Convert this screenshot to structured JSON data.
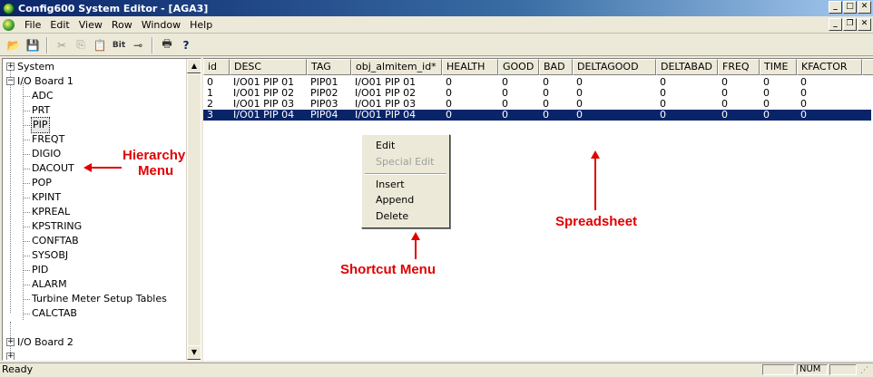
{
  "window": {
    "title": "Config600 System Editor - [AGA3]"
  },
  "menubar": {
    "items": [
      "File",
      "Edit",
      "View",
      "Row",
      "Window",
      "Help"
    ]
  },
  "toolbar": {
    "buttons": [
      {
        "icon": "open-icon",
        "glyph": "📂"
      },
      {
        "icon": "save-icon",
        "glyph": "💾"
      },
      {
        "icon": "cut-icon",
        "glyph": "✂"
      },
      {
        "icon": "copy-icon",
        "glyph": "⎘"
      },
      {
        "icon": "paste-icon",
        "glyph": "📋"
      },
      {
        "icon": "bits-icon",
        "glyph": "Bit"
      },
      {
        "icon": "link-icon",
        "glyph": "⊸"
      },
      {
        "icon": "print-icon",
        "glyph": "🖶"
      },
      {
        "icon": "help-icon",
        "glyph": "?"
      }
    ]
  },
  "tree": {
    "root_system": "System",
    "root_board1": "I/O Board 1",
    "children": [
      "ADC",
      "PRT",
      "PIP",
      "FREQT",
      "DIGIO",
      "DACOUT",
      "POP",
      "KPINT",
      "KPREAL",
      "KPSTRING",
      "CONFTAB",
      "SYSOBJ",
      "PID",
      "ALARM",
      "Turbine Meter Setup Tables",
      "CALCTAB"
    ],
    "root_board2": "I/O Board 2",
    "selected": "PIP"
  },
  "grid": {
    "columns": [
      "id",
      "DESC",
      "TAG",
      "obj_almitem_id*",
      "HEALTH",
      "GOOD",
      "BAD",
      "DELTAGOOD",
      "DELTABAD",
      "FREQ",
      "TIME",
      "KFACTOR",
      ""
    ],
    "rows": [
      [
        "0",
        "I/O01 PIP 01",
        "PIP01",
        "I/O01 PIP 01",
        "0",
        "0",
        "0",
        "0",
        "0",
        "0",
        "0",
        "0"
      ],
      [
        "1",
        "I/O01 PIP 02",
        "PIP02",
        "I/O01 PIP 02",
        "0",
        "0",
        "0",
        "0",
        "0",
        "0",
        "0",
        "0"
      ],
      [
        "2",
        "I/O01 PIP 03",
        "PIP03",
        "I/O01 PIP 03",
        "0",
        "0",
        "0",
        "0",
        "0",
        "0",
        "0",
        "0"
      ],
      [
        "3",
        "I/O01 PIP 04",
        "PIP04",
        "I/O01 PIP 04",
        "0",
        "0",
        "0",
        "0",
        "0",
        "0",
        "0",
        "0"
      ]
    ],
    "selected_row": 3
  },
  "context_menu": {
    "items": [
      {
        "label": "Edit",
        "enabled": true
      },
      {
        "label": "Special Edit",
        "enabled": false
      },
      {
        "label": "Insert",
        "enabled": true
      },
      {
        "label": "Append",
        "enabled": true
      },
      {
        "label": "Delete",
        "enabled": true
      }
    ]
  },
  "annotations": {
    "hierarchy_line1": "Hierarchy",
    "hierarchy_line2": "Menu",
    "shortcut": "Shortcut Menu",
    "spreadsheet": "Spreadsheet",
    "color": "#e00000"
  },
  "statusbar": {
    "text": "Ready",
    "num": "NUM"
  }
}
